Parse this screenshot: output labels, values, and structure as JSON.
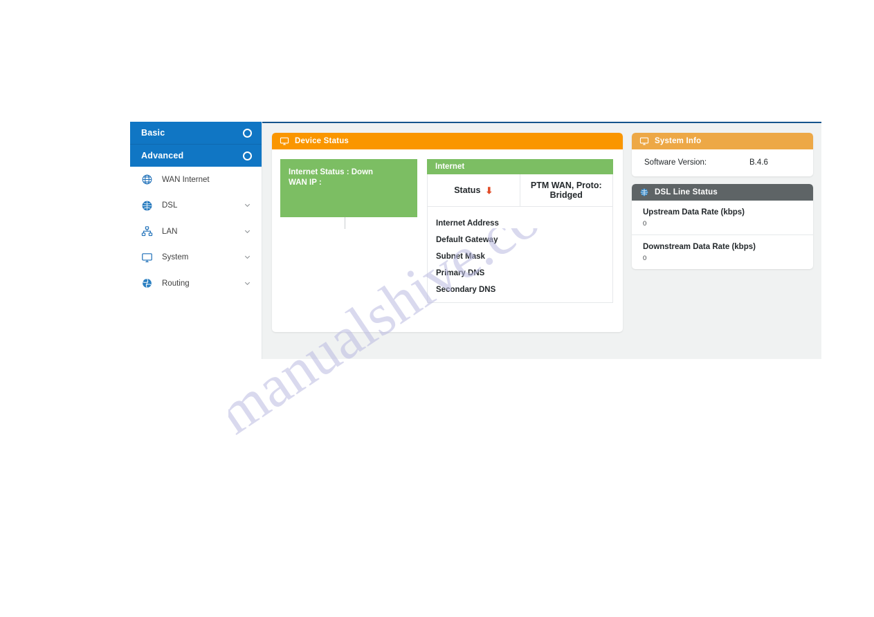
{
  "sidebar": {
    "primary": [
      {
        "label": "Basic",
        "icon": "circle-icon"
      },
      {
        "label": "Advanced",
        "icon": "circle-icon"
      }
    ],
    "items": [
      {
        "label": "WAN Internet",
        "icon": "globe-icon",
        "chevron": false
      },
      {
        "label": "DSL",
        "icon": "globe-icon",
        "chevron": true
      },
      {
        "label": "LAN",
        "icon": "network-icon",
        "chevron": true
      },
      {
        "label": "System",
        "icon": "monitor-icon",
        "chevron": true
      },
      {
        "label": "Routing",
        "icon": "routing-icon",
        "chevron": true
      }
    ]
  },
  "device_status": {
    "title": "Device Status",
    "icon": "monitor-icon",
    "summary": {
      "internet_status_label": "Internet Status :",
      "internet_status_value": "Down",
      "wan_ip_label": "WAN IP :",
      "wan_ip_value": ""
    },
    "internet": {
      "title": "Internet",
      "status_label": "Status",
      "status_icon": "down-arrow-icon",
      "status_value": "PTM WAN, Proto: Bridged",
      "fields": [
        {
          "label": "Internet Address",
          "value": ""
        },
        {
          "label": "Default Gateway",
          "value": ""
        },
        {
          "label": "Subnet Mask",
          "value": ""
        },
        {
          "label": "Primary DNS",
          "value": ""
        },
        {
          "label": "Secondary DNS",
          "value": ""
        }
      ]
    }
  },
  "system_info": {
    "title": "System Info",
    "icon": "monitor-icon",
    "software_version_label": "Software Version:",
    "software_version_value": "B.4.6"
  },
  "dsl_line_status": {
    "title": "DSL Line Status",
    "icon": "globe-icon",
    "rows": [
      {
        "label": "Upstream Data Rate (kbps)",
        "value": "0"
      },
      {
        "label": "Downstream Data Rate (kbps)",
        "value": "0"
      }
    ]
  },
  "watermark": {
    "text": "manualshive.com"
  },
  "colors": {
    "nav_blue": "#1076c4",
    "accent_orange": "#fa9600",
    "accent_orange_light": "#eda846",
    "accent_green": "#7cbe63",
    "accent_gray": "#5e6466",
    "status_red": "#e14b27",
    "content_bg": "#f0f2f2",
    "top_rule": "#15548c"
  }
}
